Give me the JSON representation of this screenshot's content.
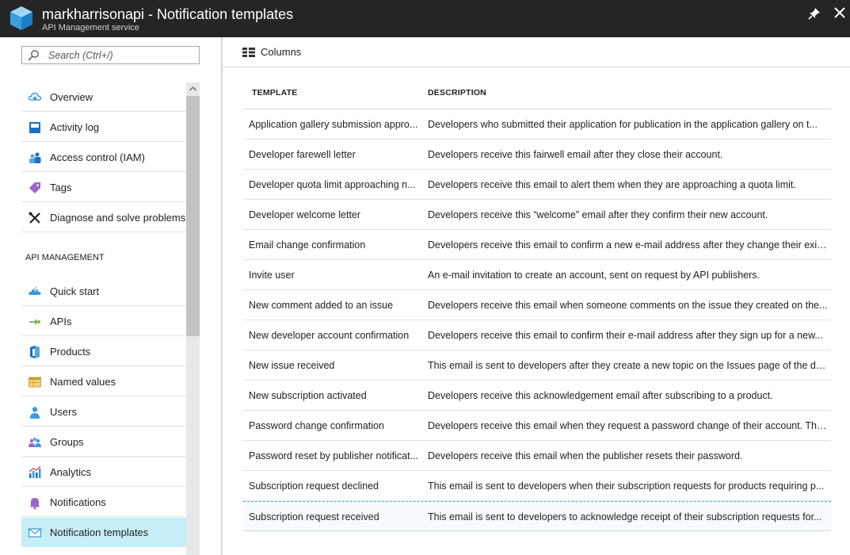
{
  "window": {
    "title": "markharrisonapi - Notification templates",
    "subtitle": "API Management service"
  },
  "search": {
    "placeholder": "Search (Ctrl+/)"
  },
  "menu": {
    "items": [
      {
        "label": "Overview",
        "icon": "overview-icon"
      },
      {
        "label": "Activity log",
        "icon": "activity-log-icon"
      },
      {
        "label": "Access control (IAM)",
        "icon": "access-control-icon"
      },
      {
        "label": "Tags",
        "icon": "tag-icon"
      },
      {
        "label": "Diagnose and solve problems",
        "icon": "wrench-icon"
      }
    ],
    "section_label": "API MANAGEMENT",
    "api_items": [
      {
        "label": "Quick start",
        "icon": "quick-start-icon"
      },
      {
        "label": "APIs",
        "icon": "apis-icon"
      },
      {
        "label": "Products",
        "icon": "products-icon"
      },
      {
        "label": "Named values",
        "icon": "named-values-icon"
      },
      {
        "label": "Users",
        "icon": "user-icon"
      },
      {
        "label": "Groups",
        "icon": "groups-icon"
      },
      {
        "label": "Analytics",
        "icon": "analytics-icon"
      },
      {
        "label": "Notifications",
        "icon": "bell-icon"
      },
      {
        "label": "Notification templates",
        "icon": "envelope-icon",
        "selected": true
      }
    ]
  },
  "toolbar": {
    "columns_label": "Columns"
  },
  "table": {
    "headers": [
      "TEMPLATE",
      "DESCRIPTION"
    ],
    "rows": [
      [
        "Application gallery submission appro...",
        "Developers who submitted their application for publication in the application gallery on t..."
      ],
      [
        "Developer farewell letter",
        "Developers receive this fairwell email after they close their account."
      ],
      [
        "Developer quota limit approaching n...",
        "Developers receive this email to alert them when they are approaching a quota limit."
      ],
      [
        "Developer welcome letter",
        "Developers receive this “welcome” email after they confirm their new account."
      ],
      [
        "Email change confirmation",
        "Developers receive this email to confirm a new e-mail address after they change their exis..."
      ],
      [
        "Invite user",
        "An e-mail invitation to create an account, sent on request by API publishers."
      ],
      [
        "New comment added to an issue",
        "Developers receive this email when someone comments on the issue they created on the..."
      ],
      [
        "New developer account confirmation",
        "Developers receive this email to confirm their e-mail address after they sign up for a new..."
      ],
      [
        "New issue received",
        "This email is sent to developers after they create a new topic on the Issues page of the de..."
      ],
      [
        "New subscription activated",
        "Developers receive this acknowledgement email after subscribing to a product."
      ],
      [
        "Password change confirmation",
        "Developers receive this email when they request a password change of their account. The..."
      ],
      [
        "Password reset by publisher notificat...",
        "Developers receive this email when the publisher resets their password."
      ],
      [
        "Subscription request declined",
        "This email is sent to developers when their subscription requests for products requiring p..."
      ],
      [
        "Subscription request received",
        "This email is sent to developers to acknowledge receipt of their subscription requests for..."
      ]
    ]
  },
  "colors": {
    "titlebar_bg": "#252525",
    "selected_bg": "#c7eef8",
    "accent_blue": "#0078d4"
  }
}
